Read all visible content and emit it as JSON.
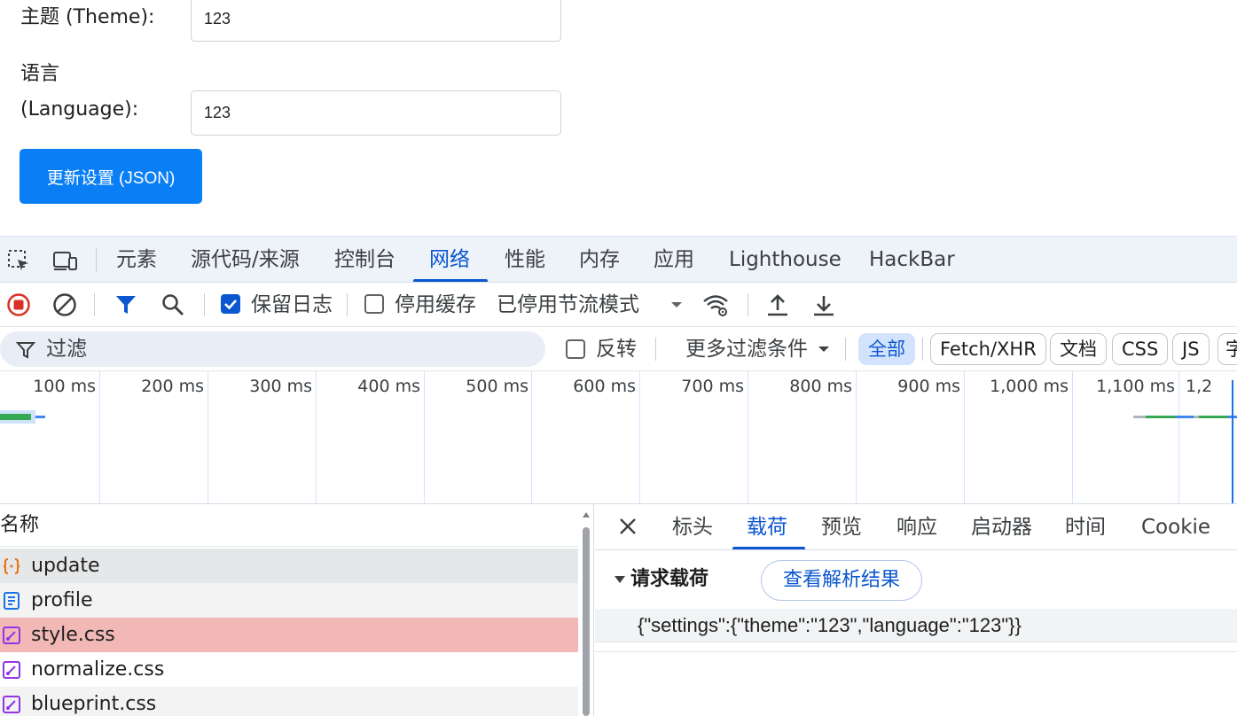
{
  "form": {
    "theme_label": "主题 (Theme):",
    "theme_value": "123",
    "language_label_1": "语言",
    "language_label_2": "(Language):",
    "language_value": "123",
    "submit_label": "更新设置 (JSON)"
  },
  "devtools": {
    "tabs": [
      {
        "label": "元素"
      },
      {
        "label": "源代码/来源"
      },
      {
        "label": "控制台"
      },
      {
        "label": "网络",
        "active": true
      },
      {
        "label": "性能"
      },
      {
        "label": "内存"
      },
      {
        "label": "应用"
      },
      {
        "label": "Lighthouse"
      },
      {
        "label": "HackBar"
      }
    ],
    "toolbar": {
      "preserve_log_label": "保留日志",
      "preserve_log_checked": true,
      "disable_cache_label": "停用缓存",
      "disable_cache_checked": false,
      "throttling_label": "已停用节流模式"
    },
    "filter": {
      "placeholder": "过滤",
      "invert_label": "反转",
      "more_filters_label": "更多过滤条件",
      "type_chips": [
        "全部",
        "Fetch/XHR",
        "文档",
        "CSS",
        "JS",
        "字"
      ],
      "active_chip": "全部"
    },
    "timeline": {
      "tick_labels": [
        "100 ms",
        "200 ms",
        "300 ms",
        "400 ms",
        "500 ms",
        "600 ms",
        "700 ms",
        "800 ms",
        "900 ms",
        "1,000 ms",
        "1,100 ms",
        "1,2"
      ]
    },
    "requests": {
      "column_name": "名称",
      "rows": [
        {
          "name": "update",
          "type": "fetch",
          "state": "selected"
        },
        {
          "name": "profile",
          "type": "document",
          "state": "normal"
        },
        {
          "name": "style.css",
          "type": "stylesheet",
          "state": "error"
        },
        {
          "name": "normalize.css",
          "type": "stylesheet",
          "state": "normal"
        },
        {
          "name": "blueprint.css",
          "type": "stylesheet",
          "state": "normal"
        }
      ]
    },
    "detail": {
      "tabs": [
        "标头",
        "载荷",
        "预览",
        "响应",
        "启动器",
        "时间",
        "Cookie"
      ],
      "active_tab": "载荷",
      "payload_title": "请求载荷",
      "view_parsed_label": "查看解析结果",
      "payload_text": "{\"settings\":{\"theme\":\"123\",\"language\":\"123\"}}"
    }
  },
  "colors": {
    "accent": "#0b57d0",
    "submit": "#0a7ff5",
    "selected_row": "#e6e7e8",
    "error_row": "#f2b8b5",
    "record_red": "#d93025"
  }
}
